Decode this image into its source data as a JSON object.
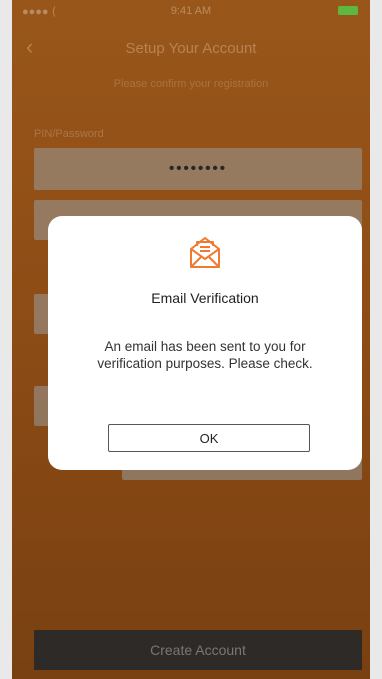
{
  "status_bar": {
    "carrier": "●●●● ⟨",
    "time": "9:41 AM",
    "right": "⏰ ✱ 100%"
  },
  "nav": {
    "back_icon": "chevron-left-icon",
    "title": "Setup Your Account"
  },
  "form": {
    "subtitle": "Please confirm your registration",
    "password_label": "PIN/Password",
    "password_value": "••••••••",
    "create_button": "Create Account"
  },
  "dialog": {
    "icon": "open-envelope-icon",
    "title": "Email Verification",
    "message": "An email has been sent to you for verification purposes. Please check.",
    "ok_label": "OK",
    "accent_color": "#f07a2f"
  }
}
